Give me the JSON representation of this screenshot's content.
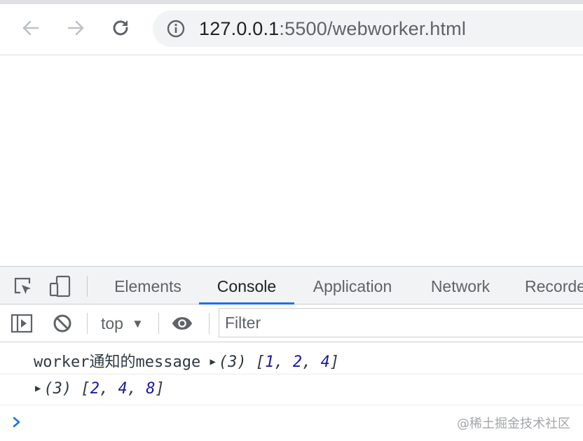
{
  "browser": {
    "url_host": "127.0.0.1",
    "url_rest": ":5500/webworker.html",
    "icons": {
      "back": "arrow-left-icon",
      "forward": "arrow-right-icon",
      "reload": "reload-icon",
      "site_info": "info-icon"
    }
  },
  "devtools": {
    "tabs": [
      {
        "label": "Elements",
        "active": false
      },
      {
        "label": "Console",
        "active": true
      },
      {
        "label": "Application",
        "active": false
      },
      {
        "label": "Network",
        "active": false
      },
      {
        "label": "Recorde",
        "active": false
      }
    ],
    "toolbar_icons": {
      "inspect": "inspect-element-icon",
      "device": "device-toolbar-icon",
      "sidebar": "show-sidebar-icon",
      "clear": "clear-console-icon",
      "eye": "live-expression-icon"
    },
    "context": "top",
    "filter_placeholder": "Filter",
    "accent_color": "#1a73e8"
  },
  "console": {
    "messages": [
      {
        "text": "worker通知的message",
        "array_count": "(3)",
        "values": [
          "1",
          "2",
          "4"
        ]
      },
      {
        "text": "",
        "array_count": "(3)",
        "values": [
          "2",
          "4",
          "8"
        ]
      }
    ],
    "prompt_icon": "chevron-right-icon"
  },
  "watermark": "@稀土掘金技术社区"
}
